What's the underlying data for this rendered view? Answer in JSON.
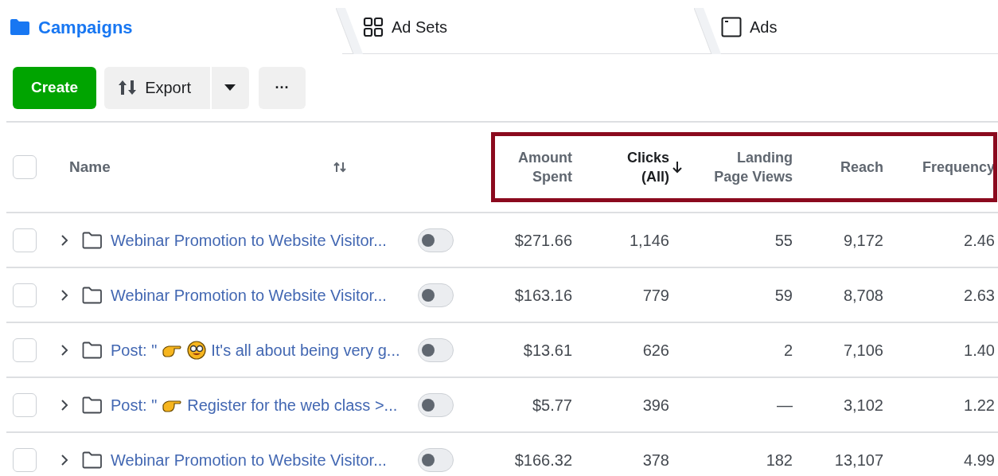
{
  "tabs": [
    {
      "label": "Campaigns",
      "kind": "folder",
      "selected": true
    },
    {
      "label": "Ad Sets",
      "kind": "grid",
      "selected": false
    },
    {
      "label": "Ads",
      "kind": "window",
      "selected": false
    }
  ],
  "toolbar": {
    "create": "Create",
    "export": "Export",
    "more": "···"
  },
  "table": {
    "all_checked": false,
    "name_column": "Name",
    "columns": [
      {
        "label": "Amount Spent",
        "sorted": false
      },
      {
        "label": "Clicks (All)",
        "sorted": true
      },
      {
        "label": "Landing Page Views",
        "sorted": false
      },
      {
        "label": "Reach",
        "sorted": false
      },
      {
        "label": "Frequency",
        "sorted": false
      }
    ],
    "rows": [
      {
        "name": [
          {
            "kind": "text",
            "text": "Webinar Promotion to Website Visitor..."
          }
        ],
        "on": false,
        "checked": false,
        "values": [
          "$271.66",
          "1,146",
          "55",
          "9,172",
          "2.46"
        ]
      },
      {
        "name": [
          {
            "kind": "text",
            "text": "Webinar Promotion to Website Visitor..."
          }
        ],
        "on": false,
        "checked": false,
        "values": [
          "$163.16",
          "779",
          "59",
          "8,708",
          "2.63"
        ]
      },
      {
        "name": [
          {
            "kind": "text",
            "text": "Post: \""
          },
          {
            "kind": "pointing-hand"
          },
          {
            "kind": "nerd-face"
          },
          {
            "kind": "text",
            "text": "It's all about being very g..."
          }
        ],
        "on": false,
        "checked": false,
        "values": [
          "$13.61",
          "626",
          "2",
          "7,106",
          "1.40"
        ]
      },
      {
        "name": [
          {
            "kind": "text",
            "text": "Post: \""
          },
          {
            "kind": "pointing-hand"
          },
          {
            "kind": "text",
            "text": "Register for the web class >..."
          }
        ],
        "on": false,
        "checked": false,
        "values": [
          "$5.77",
          "396",
          "—",
          "3,102",
          "1.22"
        ]
      },
      {
        "name": [
          {
            "kind": "text",
            "text": "Webinar Promotion to Website Visitor..."
          }
        ],
        "on": false,
        "checked": false,
        "values": [
          "$166.32",
          "378",
          "182",
          "13,107",
          "4.99"
        ]
      }
    ]
  }
}
